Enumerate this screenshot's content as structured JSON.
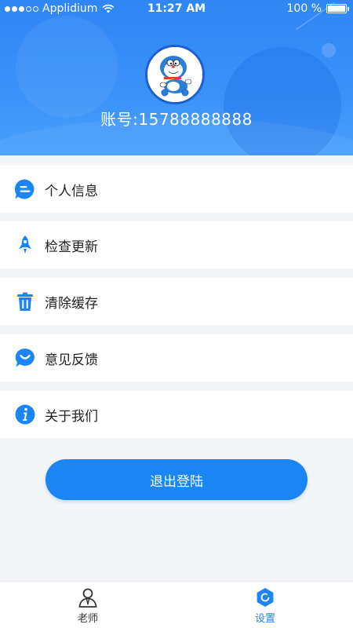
{
  "status_bar": {
    "carrier": "Applidium",
    "time": "11:27 AM",
    "battery": "100 %"
  },
  "profile": {
    "account_text": "账号:15788888888",
    "avatar_icon": "doraemon-avatar"
  },
  "menu": [
    {
      "label": "个人信息",
      "icon": "message-icon"
    },
    {
      "label": "检查更新",
      "icon": "rocket-icon"
    },
    {
      "label": "清除缓存",
      "icon": "trash-icon"
    },
    {
      "label": "意见反馈",
      "icon": "feedback-icon"
    },
    {
      "label": "关于我们",
      "icon": "info-icon"
    }
  ],
  "logout_label": "退出登陆",
  "tabbar": {
    "teacher_label": "老师",
    "settings_label": "设置"
  },
  "colors": {
    "primary": "#1a85f3",
    "header": "#3a92f8",
    "background": "#f3f5f8"
  }
}
